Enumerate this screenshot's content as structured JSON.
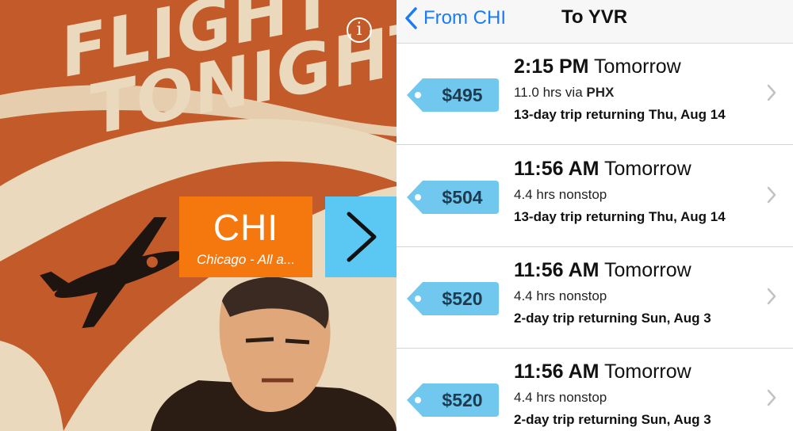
{
  "poster": {
    "title_line1": "FLIGHT",
    "title_line2": "TONIGHT!",
    "info_label": "i",
    "origin_code": "CHI",
    "origin_name": "Chicago - All a...",
    "colors": {
      "orange": "#c25a2a",
      "cream": "#ead9bd",
      "origin_box": "#f5780f",
      "go_button": "#5bc8f4"
    }
  },
  "nav": {
    "back_label": "From CHI",
    "title": "To YVR",
    "accent": "#1a7cf5"
  },
  "flights": [
    {
      "price": "$495",
      "time": "2:15 PM",
      "day": "Tomorrow",
      "hours": "11.0",
      "hrs_word": "hrs",
      "route_word": "via",
      "route_code": "PHX",
      "trip": "13-day trip returning Thu, Aug 14"
    },
    {
      "price": "$504",
      "time": "11:56 AM",
      "day": "Tomorrow",
      "hours": "4.4",
      "hrs_word": "hrs",
      "route_word": "nonstop",
      "route_code": "",
      "trip": "13-day trip returning Thu, Aug 14"
    },
    {
      "price": "$520",
      "time": "11:56 AM",
      "day": "Tomorrow",
      "hours": "4.4",
      "hrs_word": "hrs",
      "route_word": "nonstop",
      "route_code": "",
      "trip": "2-day trip returning Sun, Aug 3"
    },
    {
      "price": "$520",
      "time": "11:56 AM",
      "day": "Tomorrow",
      "hours": "4.4",
      "hrs_word": "hrs",
      "route_word": "nonstop",
      "route_code": "",
      "trip": "2-day trip returning Sun, Aug 3"
    }
  ],
  "tag_color": "#71c8ef"
}
